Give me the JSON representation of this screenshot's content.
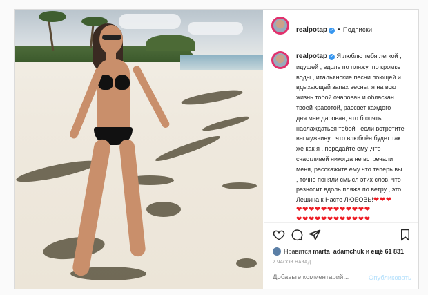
{
  "post": {
    "username": "realpotap",
    "verified": true,
    "follow_label": "Подписки",
    "caption_lines": [
      "Я люблю тебя легкой ,",
      "идущей , вдоль по пляжу ,по кромке",
      "воды , итальянские песни поющей и",
      "вдыхающей запах весны, я на всю",
      "жизнь тобой очарован и обласкан",
      "твоей красотой, рассвет каждого",
      "дня мне дарован, что б опять",
      "наслаждаться тобой , если встретите",
      "вы мужчину , что влюблён будет так",
      "же как я , передайте ему ,что",
      "счастливей никогда не встречали",
      "меня, расскажите ему что теперь вы",
      ", точно поняли смысл этих слов, что",
      "разносит вдоль пляжа по ветру , это",
      "Лешина к Насте ЛЮБОВЬ!"
    ],
    "caption_hearts_inline": "❤❤❤",
    "heart_rows": [
      "❤❤❤❤❤❤❤❤❤❤❤❤",
      "❤❤❤❤❤❤❤❤❤❤❤❤",
      "❤❤❤❤❤❤❤❤❤❤❤❤",
      "❤❤❤❤❤❤❤❤❤❤❤❤"
    ],
    "likes_prefix": "Нравится",
    "likes_user": "marta_adamchuk",
    "likes_mid": "и",
    "likes_count": "ещё 61 831",
    "time": "2 ЧАСОВ НАЗАД",
    "comment_placeholder": "Добавьте комментарий...",
    "publish_label": "Опубликовать"
  },
  "icons": [
    "heart-icon",
    "comment-icon",
    "share-icon",
    "bookmark-icon",
    "verified-icon"
  ],
  "colors": {
    "accent": "#3897f0",
    "heart": "#ed1c24",
    "muted": "#8e8e8e",
    "publish_disabled": "#b2dffc"
  }
}
